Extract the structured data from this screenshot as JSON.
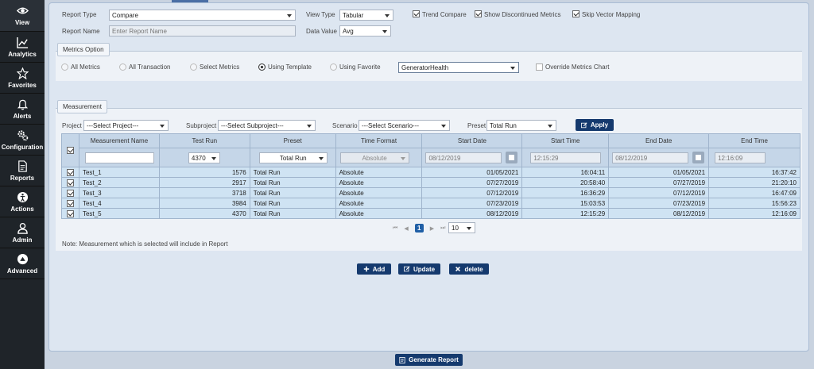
{
  "sidebar": [
    {
      "id": "view",
      "label": "View",
      "icon": "eye-icon"
    },
    {
      "id": "analytics",
      "label": "Analytics",
      "icon": "chart-icon"
    },
    {
      "id": "favorites",
      "label": "Favorites",
      "icon": "star-icon"
    },
    {
      "id": "alerts",
      "label": "Alerts",
      "icon": "bell-icon"
    },
    {
      "id": "configuration",
      "label": "Configuration",
      "icon": "gears-icon"
    },
    {
      "id": "reports",
      "label": "Reports",
      "icon": "document-icon"
    },
    {
      "id": "actions",
      "label": "Actions",
      "icon": "actions-icon"
    },
    {
      "id": "admin",
      "label": "Admin",
      "icon": "user-icon"
    },
    {
      "id": "advanced",
      "label": "Advanced",
      "icon": "advanced-icon"
    }
  ],
  "form": {
    "report_type_label": "Report Type",
    "report_type_value": "Compare",
    "report_name_label": "Report Name",
    "report_name_placeholder": "Enter Report Name",
    "view_type_label": "View Type",
    "view_type_value": "Tabular",
    "data_value_label": "Data Value",
    "data_value_value": "Avg",
    "trend_compare": "Trend Compare",
    "show_discontinued": "Show Discontinued Metrics",
    "skip_vector": "Skip Vector Mapping"
  },
  "metrics": {
    "legend": "Metrics Option",
    "options": [
      "All Metrics",
      "All Transaction",
      "Select Metrics",
      "Using Template",
      "Using Favorite"
    ],
    "selected": "Using Template",
    "template_value": "GeneratorHealth",
    "override_label": "Override Metrics Chart"
  },
  "measurement": {
    "legend": "Measurement",
    "project_label": "Project",
    "project_value": "---Select Project---",
    "subproject_label": "Subproject",
    "subproject_value": "---Select Subproject---",
    "scenario_label": "Scenario",
    "scenario_value": "---Select Scenario---",
    "preset_label": "Preset",
    "preset_value": "Total Run",
    "apply_label": "Apply",
    "columns": [
      "Measurement Name",
      "Test Run",
      "Preset",
      "Time Format",
      "Start Date",
      "Start Time",
      "End Date",
      "End Time"
    ],
    "filter": {
      "test_run": "4370",
      "preset": "Total Run",
      "time_format": "Absolute",
      "start_date": "08/12/2019",
      "start_time": "12:15:29",
      "end_date": "08/12/2019",
      "end_time": "12:16:09"
    },
    "rows": [
      {
        "name": "Test_1",
        "run": "1576",
        "preset": "Total Run",
        "format": "Absolute",
        "start_date": "01/05/2021",
        "start_time": "16:04:11",
        "end_date": "01/05/2021",
        "end_time": "16:37:42"
      },
      {
        "name": "Test_2",
        "run": "2917",
        "preset": "Total Run",
        "format": "Absolute",
        "start_date": "07/27/2019",
        "start_time": "20:58:40",
        "end_date": "07/27/2019",
        "end_time": "21:20:10"
      },
      {
        "name": "Test_3",
        "run": "3718",
        "preset": "Total Run",
        "format": "Absolute",
        "start_date": "07/12/2019",
        "start_time": "16:36:29",
        "end_date": "07/12/2019",
        "end_time": "16:47:09"
      },
      {
        "name": "Test_4",
        "run": "3984",
        "preset": "Total Run",
        "format": "Absolute",
        "start_date": "07/23/2019",
        "start_time": "15:03:53",
        "end_date": "07/23/2019",
        "end_time": "15:56:23"
      },
      {
        "name": "Test_5",
        "run": "4370",
        "preset": "Total Run",
        "format": "Absolute",
        "start_date": "08/12/2019",
        "start_time": "12:15:29",
        "end_date": "08/12/2019",
        "end_time": "12:16:09"
      }
    ],
    "pagination": {
      "current_page": "1",
      "page_size": "10"
    },
    "note": "Note: Measurement which is selected will include in Report"
  },
  "actions": {
    "add": "Add",
    "update": "Update",
    "delete": "delete",
    "generate": "Generate Report"
  }
}
